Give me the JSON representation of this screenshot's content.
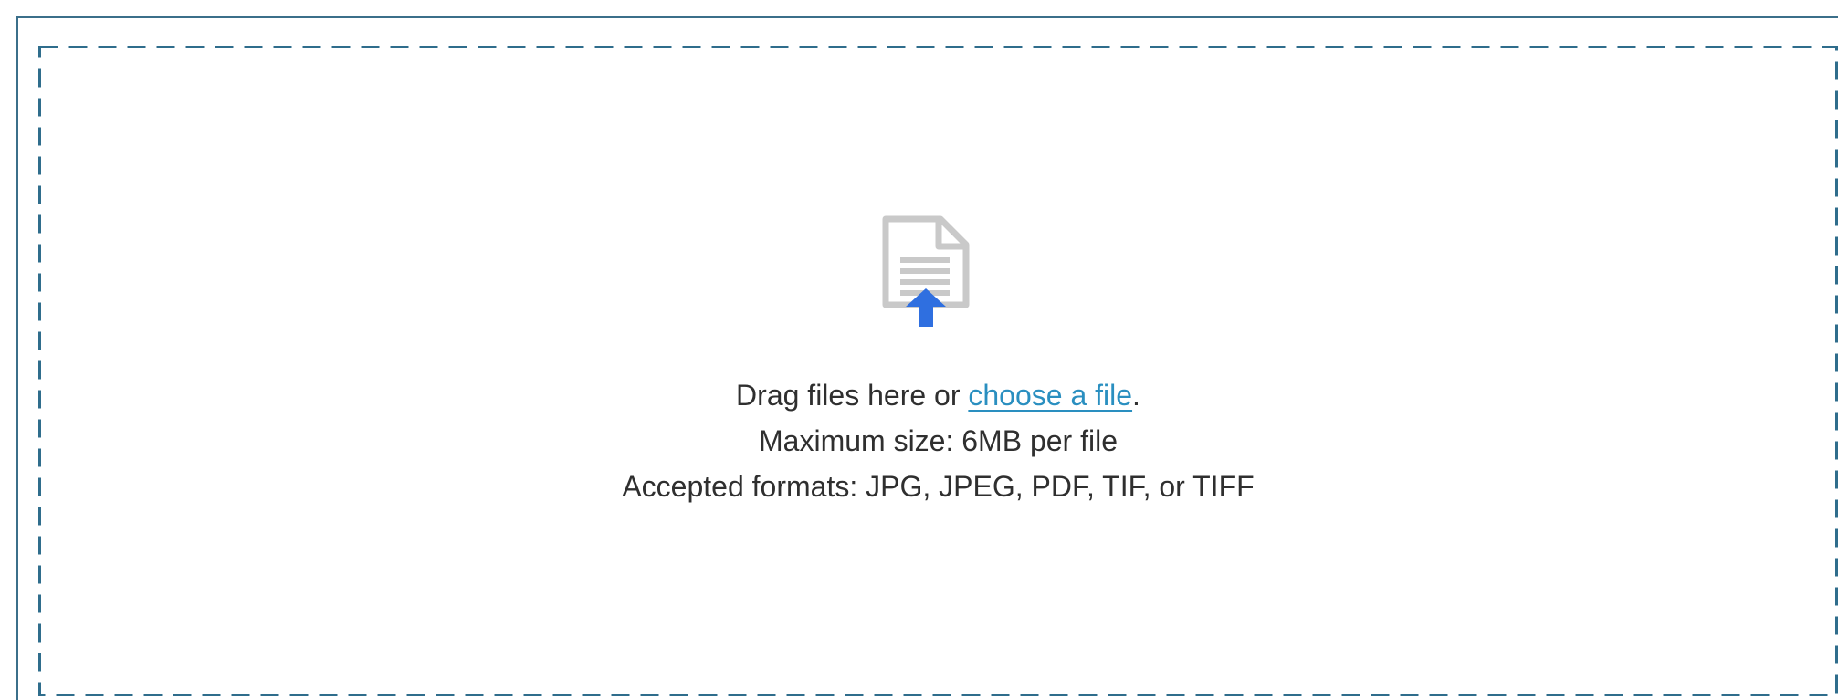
{
  "dropzone": {
    "instruction_prefix": "Drag files here or ",
    "link_text": "choose a file",
    "instruction_suffix": ".",
    "max_size_text": "Maximum size: 6MB per file",
    "formats_text": "Accepted formats: JPG, JPEG, PDF, TIF, or TIFF",
    "icon": "file-upload-icon"
  },
  "colors": {
    "frame_border": "#3b6f8a",
    "dash_border": "#2f6d8c",
    "link": "#2a8fc0",
    "icon_gray": "#c9c9c9",
    "icon_arrow": "#2f6fe0",
    "text": "#2f2f2f"
  }
}
